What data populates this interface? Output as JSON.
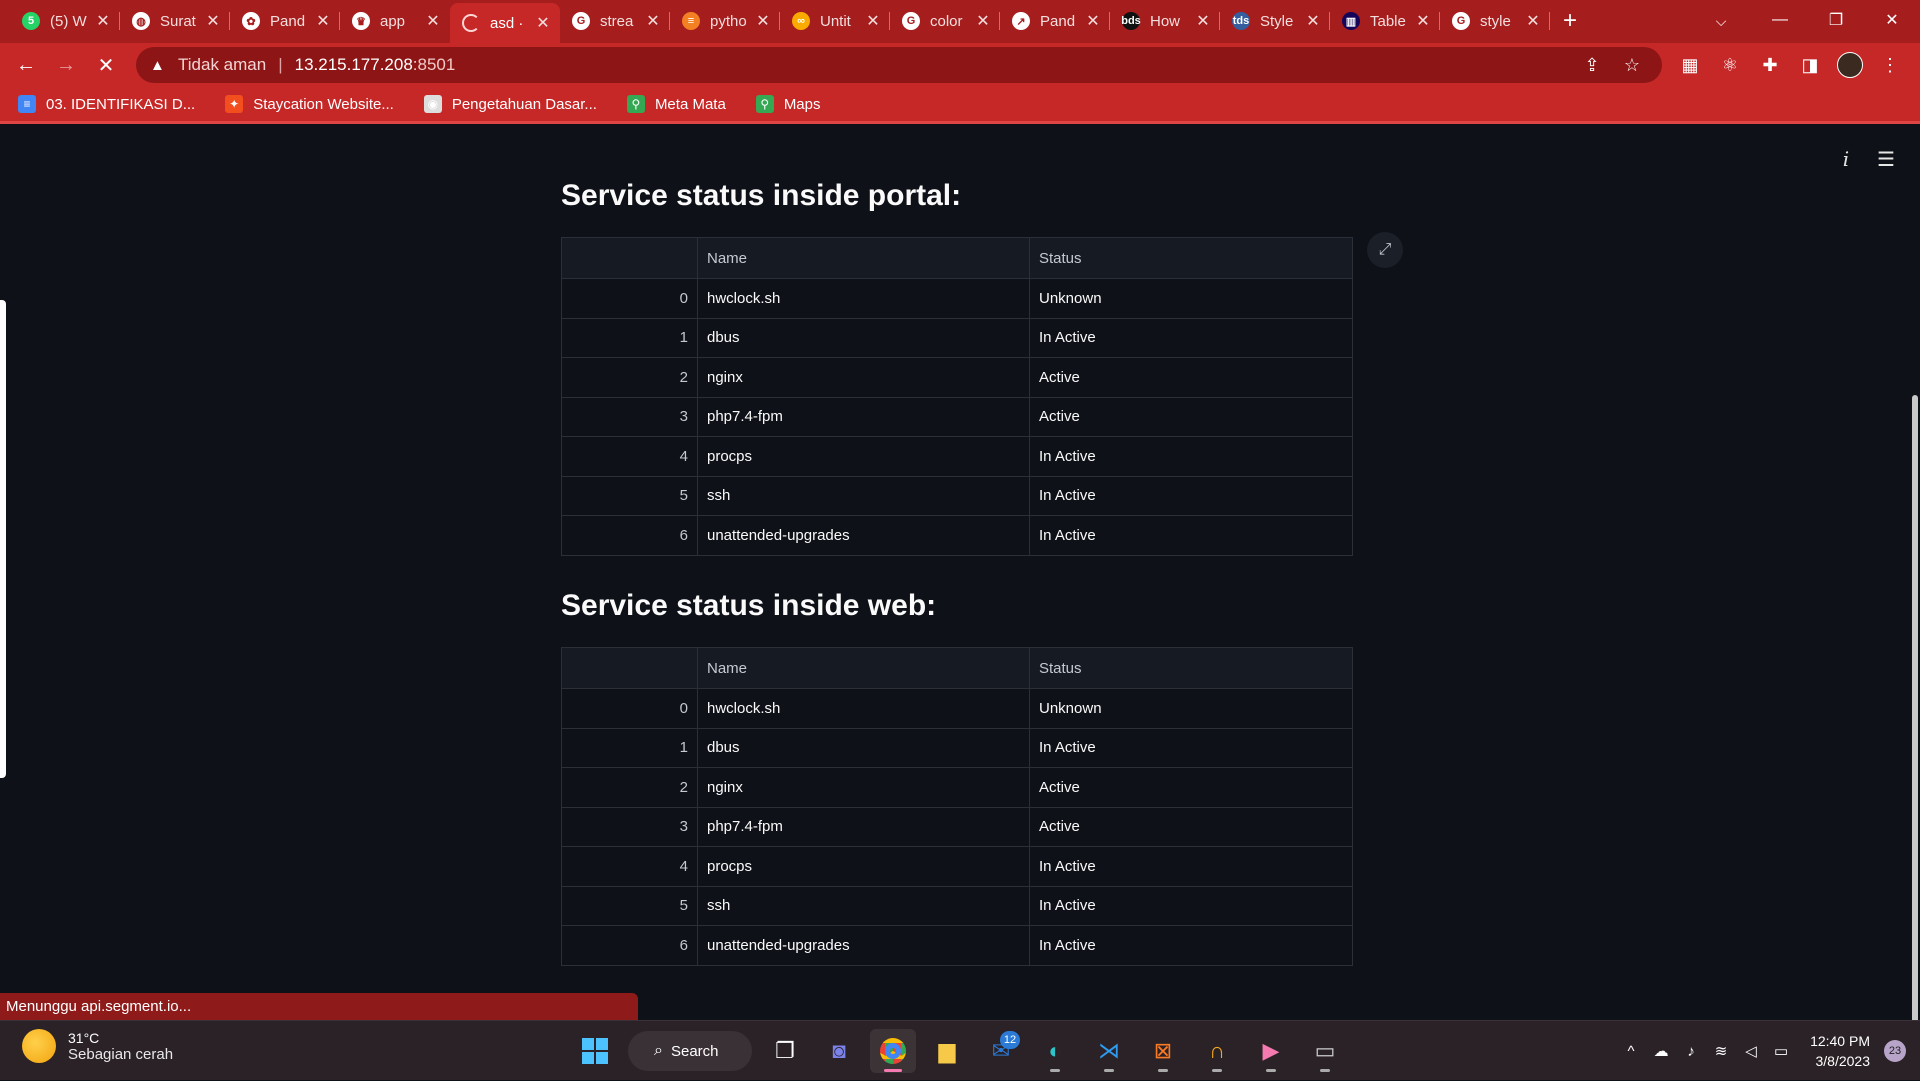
{
  "browser": {
    "tabs": [
      {
        "icon": "whatsapp-icon",
        "label": "(5) W",
        "glyph": "5",
        "color": "#25d366"
      },
      {
        "icon": "globe-icon",
        "label": "Surat",
        "glyph": "◍",
        "color": "#ffffff"
      },
      {
        "icon": "chatgpt-icon",
        "label": "Pand",
        "glyph": "✿",
        "color": "#ffffff"
      },
      {
        "icon": "streamlit-crown-icon",
        "label": "app",
        "glyph": "♛",
        "color": "#ffffff"
      },
      {
        "icon": "loading-spinner-icon",
        "label": "asd ·",
        "glyph": "",
        "color": "#ffffff"
      },
      {
        "icon": "google-icon",
        "label": "strea",
        "glyph": "G",
        "color": "#ffffff"
      },
      {
        "icon": "stackoverflow-icon",
        "label": "pytho",
        "glyph": "≡",
        "color": "#f48024"
      },
      {
        "icon": "infinity-icon",
        "label": "Untit",
        "glyph": "∞",
        "color": "#f9ab00"
      },
      {
        "icon": "google-icon",
        "label": "color",
        "glyph": "G",
        "color": "#ffffff"
      },
      {
        "icon": "pandas-icon",
        "label": "Pand",
        "glyph": "↗",
        "color": "#ffffff"
      },
      {
        "icon": "bds-icon",
        "label": "How",
        "glyph": "bds",
        "color": "#111111"
      },
      {
        "icon": "tds-icon",
        "label": "Style",
        "glyph": "tds",
        "color": "#355e9e"
      },
      {
        "icon": "pandas-docs-icon",
        "label": "Table",
        "glyph": "▥",
        "color": "#150458"
      },
      {
        "icon": "google-icon",
        "label": "style",
        "glyph": "G",
        "color": "#ffffff"
      }
    ],
    "active_tab_index": 4,
    "address": {
      "security_label": "Tidak aman",
      "host": "13.215.177.208",
      "port": ":8501"
    },
    "bookmarks": [
      {
        "icon": "google-docs-icon",
        "label": "03. IDENTIFIKASI D...",
        "color": "#4285f4",
        "glyph": "≡"
      },
      {
        "icon": "figma-icon",
        "label": "Staycation Website...",
        "color": "#f24e1e",
        "glyph": "✦"
      },
      {
        "icon": "avatar-icon",
        "label": "Pengetahuan Dasar...",
        "color": "#dddddd",
        "glyph": "◉"
      },
      {
        "icon": "maps-pin-icon",
        "label": "Meta Mata",
        "color": "#34a853",
        "glyph": "⚲"
      },
      {
        "icon": "google-maps-icon",
        "label": "Maps",
        "color": "#34a853",
        "glyph": "⚲"
      }
    ]
  },
  "page": {
    "sections": [
      {
        "title": "Service status inside portal:",
        "columns": [
          "",
          "Name",
          "Status"
        ],
        "rows": [
          [
            "0",
            "hwclock.sh",
            "Unknown"
          ],
          [
            "1",
            "dbus",
            "In Active"
          ],
          [
            "2",
            "nginx",
            "Active"
          ],
          [
            "3",
            "php7.4-fpm",
            "Active"
          ],
          [
            "4",
            "procps",
            "In Active"
          ],
          [
            "5",
            "ssh",
            "In Active"
          ],
          [
            "6",
            "unattended-upgrades",
            "In Active"
          ]
        ]
      },
      {
        "title": "Service status inside web:",
        "columns": [
          "",
          "Name",
          "Status"
        ],
        "rows": [
          [
            "0",
            "hwclock.sh",
            "Unknown"
          ],
          [
            "1",
            "dbus",
            "In Active"
          ],
          [
            "2",
            "nginx",
            "Active"
          ],
          [
            "3",
            "php7.4-fpm",
            "Active"
          ],
          [
            "4",
            "procps",
            "In Active"
          ],
          [
            "5",
            "ssh",
            "In Active"
          ],
          [
            "6",
            "unattended-upgrades",
            "In Active"
          ]
        ]
      }
    ]
  },
  "status_bar": {
    "text": "Menunggu api.segment.io..."
  },
  "taskbar": {
    "weather_temp": "31°C",
    "weather_desc": "Sebagian cerah",
    "search_label": "Search",
    "mail_badge": "12",
    "clock_time": "12:40 PM",
    "clock_date": "3/8/2023",
    "notification_count": "23"
  },
  "colors": {
    "chrome_red": "#c62828",
    "tab_strip_red": "#a51d1d",
    "page_bg": "#0e1117",
    "table_header_bg": "#161a22",
    "taskbar_bg": "#2a2226"
  }
}
